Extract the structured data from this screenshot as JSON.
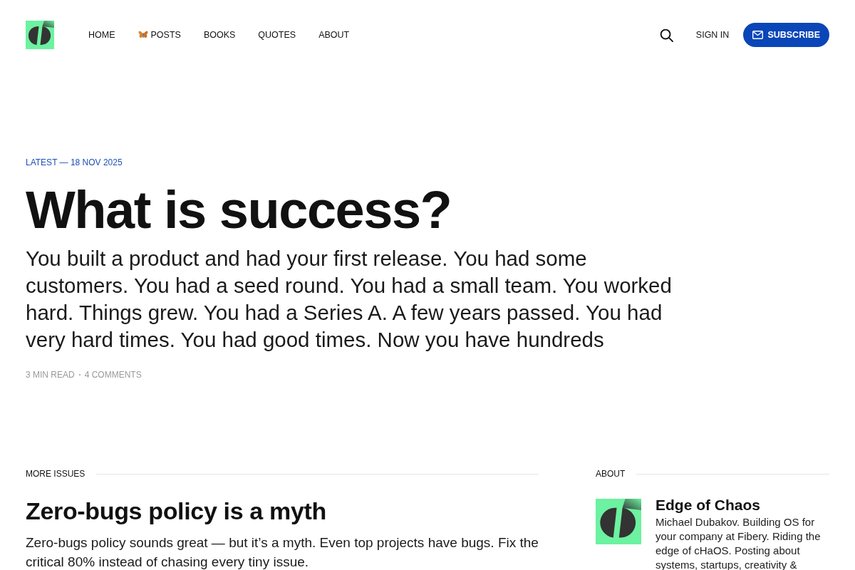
{
  "nav": [
    {
      "label": "HOME",
      "has_icon": false
    },
    {
      "label": "POSTS",
      "has_icon": true
    },
    {
      "label": "BOOKS",
      "has_icon": false
    },
    {
      "label": "QUOTES",
      "has_icon": false
    },
    {
      "label": "ABOUT",
      "has_icon": false
    }
  ],
  "header_actions": {
    "sign_in": "SIGN IN",
    "subscribe": "SUBSCRIBE"
  },
  "featured": {
    "eyebrow": "LATEST — 18 NOV 2025",
    "title": "What is success?",
    "excerpt": "You built a product and had your first release. You had some customers. You had a seed round. You had a small team. You worked hard. Things grew. You had a Series A. A few years passed. You had very hard times. You had good times. Now you have hundreds",
    "meta": [
      "3 MIN READ",
      "4 COMMENTS"
    ]
  },
  "more_issues": {
    "heading": "MORE ISSUES",
    "posts": [
      {
        "title": "Zero-bugs policy is a myth",
        "excerpt": "Zero-bugs policy sounds great — but it’s a myth. Even top projects have bugs. Fix the critical 80% instead of chasing every tiny issue."
      }
    ]
  },
  "about": {
    "heading": "ABOUT",
    "title": "Edge of Chaos",
    "description": "Michael Dubakov. Building OS for your company at Fibery. Riding the edge of cHaOS. Posting about systems, startups, creativity &"
  }
}
